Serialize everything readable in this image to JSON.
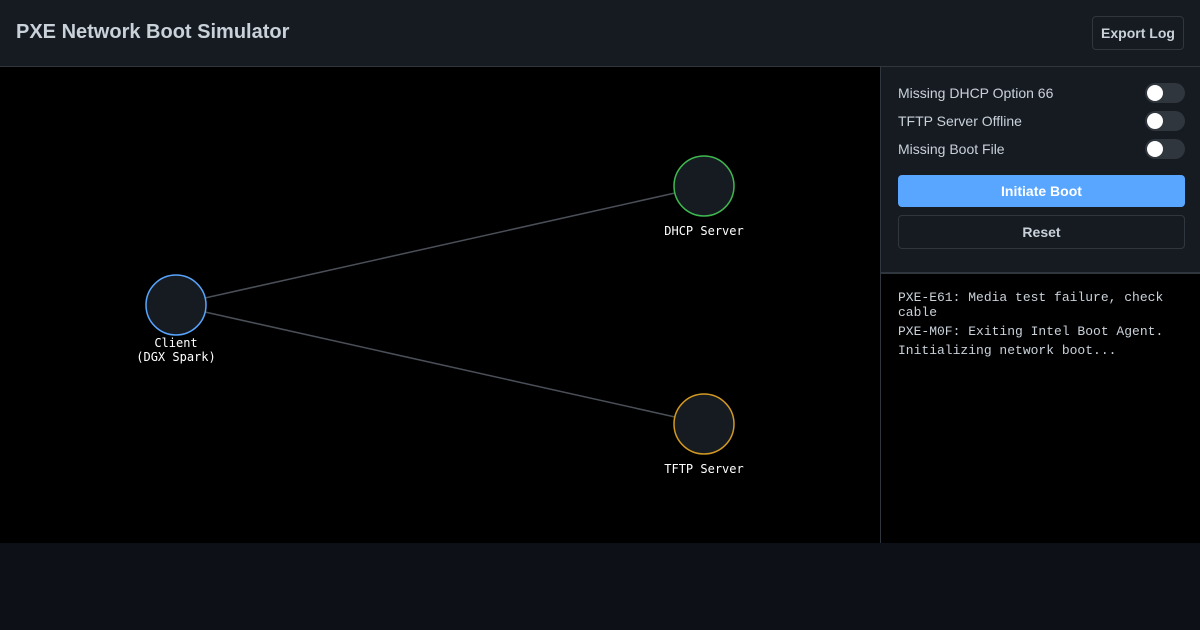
{
  "header": {
    "title": "PXE Network Boot Simulator",
    "export_label": "Export Log"
  },
  "diagram": {
    "nodes": [
      {
        "id": "client",
        "label_lines": [
          "Client",
          "(DGX Spark)"
        ],
        "color": "#58a6ff"
      },
      {
        "id": "dhcp",
        "label_lines": [
          "DHCP Server"
        ],
        "color": "#3fb950"
      },
      {
        "id": "tftp",
        "label_lines": [
          "TFTP Server"
        ],
        "color": "#d29922"
      }
    ],
    "links": [
      {
        "from": "client",
        "to": "dhcp"
      },
      {
        "from": "client",
        "to": "tftp"
      }
    ]
  },
  "controls": {
    "toggles": [
      {
        "label": "Missing DHCP Option 66",
        "on": false
      },
      {
        "label": "TFTP Server Offline",
        "on": false
      },
      {
        "label": "Missing Boot File",
        "on": false
      }
    ],
    "initiate_label": "Initiate Boot",
    "reset_label": "Reset"
  },
  "log": {
    "lines": [
      "PXE-E61: Media test failure, check cable",
      "PXE-M0F: Exiting Intel Boot Agent.",
      "Initializing network boot..."
    ]
  },
  "colors": {
    "accent": "#58a6ff",
    "dhcp": "#3fb950",
    "tftp": "#d29922",
    "link": "#4a4f58"
  }
}
